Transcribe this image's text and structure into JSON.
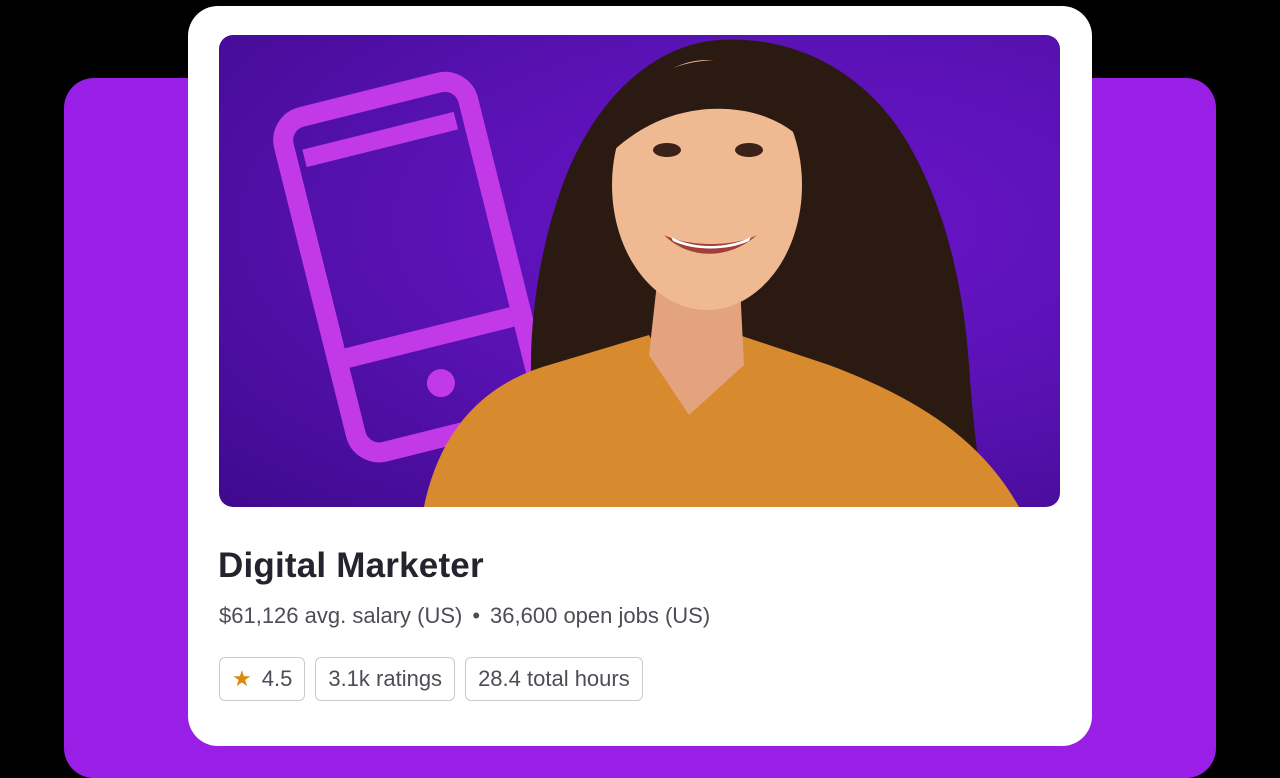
{
  "course": {
    "title": "Digital Marketer",
    "salary": "$61,126 avg. salary (US)",
    "separator": "•",
    "jobs": "36,600 open jobs (US)",
    "rating": "4.5",
    "ratings_count": "3.1k ratings",
    "total_hours": "28.4 total hours"
  },
  "icons": {
    "rating": "star-icon",
    "hero_illustration": "smartphone-icon"
  },
  "colors": {
    "backdrop_purple": "#9a1fe6",
    "hero_purple": "#5a12b5",
    "phone_outline": "#c23ae8",
    "star": "#d98a10",
    "title_text": "#24242e"
  }
}
